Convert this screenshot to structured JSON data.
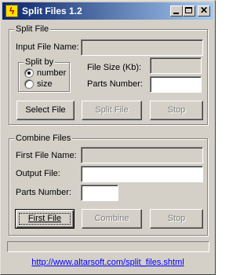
{
  "window": {
    "title": "Split Files 1.2",
    "app_icon": "lightning-bolt-icon",
    "controls": {
      "minimize_icon": "minimize-icon",
      "maximize_icon": "maximize-icon",
      "close_glyph": "✕"
    }
  },
  "split": {
    "group_label": "Split File",
    "input_file_label": "Input File Name:",
    "input_file_value": "",
    "split_by": {
      "label": "Split by",
      "options": [
        {
          "label": "number",
          "selected": true
        },
        {
          "label": "size",
          "selected": false
        }
      ]
    },
    "file_size_label": "File Size (Kb):",
    "file_size_value": "",
    "parts_number_label": "Parts Number:",
    "parts_number_value": "",
    "buttons": {
      "select_file": "Select File",
      "split_file": "Split File",
      "stop": "Stop"
    }
  },
  "combine": {
    "group_label": "Combine Files",
    "first_file_label": "First File Name:",
    "first_file_value": "",
    "output_file_label": "Output File:",
    "output_file_value": "",
    "parts_number_label": "Parts Number:",
    "parts_number_value": "",
    "buttons": {
      "first_file": "First File",
      "combine": "Combine",
      "stop": "Stop"
    }
  },
  "status": {
    "text": ""
  },
  "footer": {
    "link": "http://www.altarsoft.com/split_files.shtml"
  },
  "colors": {
    "face": "#d4d0c8",
    "title_start": "#0a246a",
    "title_end": "#a6caf0",
    "link": "#0000ff",
    "disabled_text": "#808080"
  }
}
